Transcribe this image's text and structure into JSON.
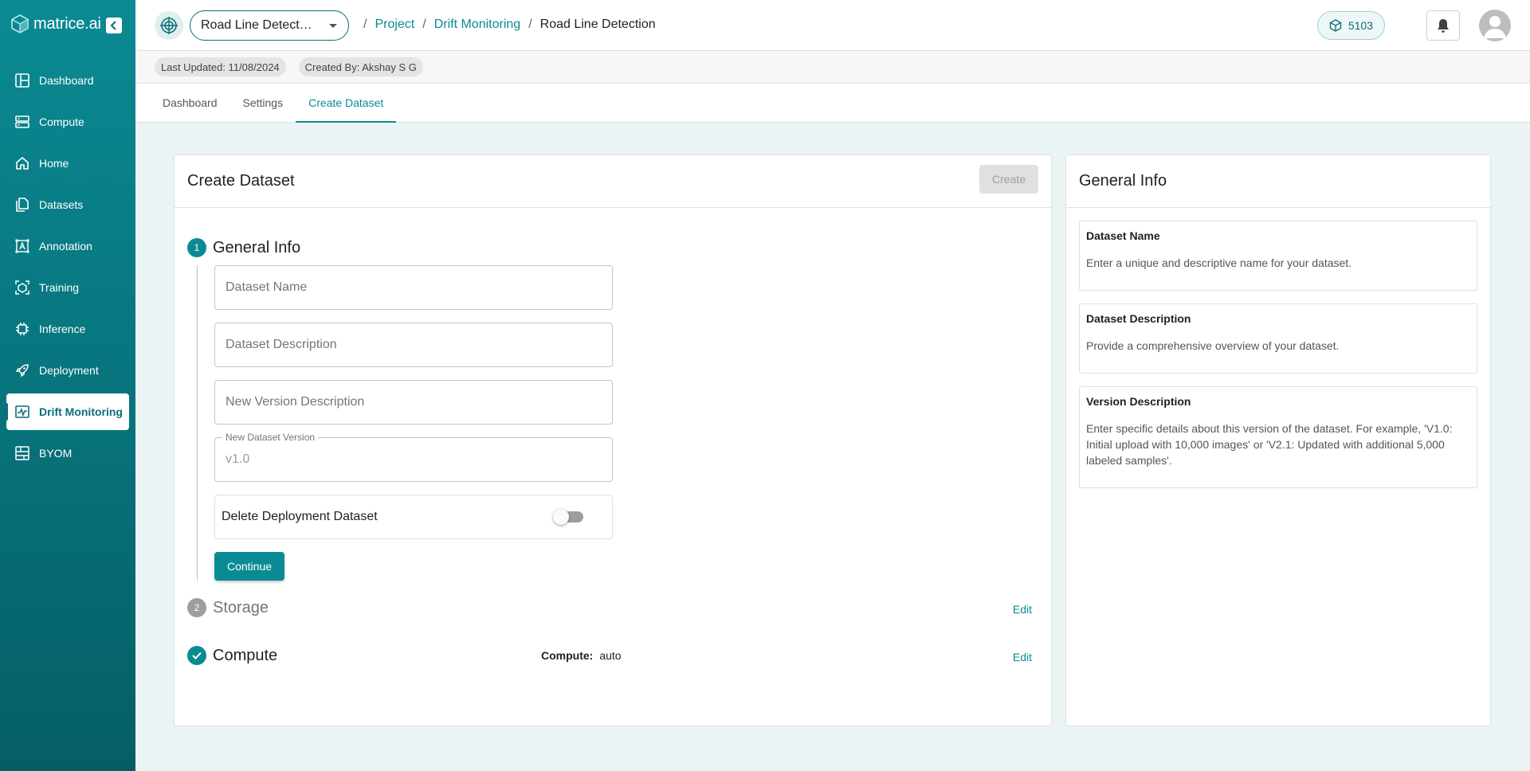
{
  "brand": {
    "name": "matrice.ai"
  },
  "sidebar": {
    "items": [
      {
        "label": "Dashboard",
        "icon": "dashboard-icon"
      },
      {
        "label": "Compute",
        "icon": "server-icon"
      },
      {
        "label": "Home",
        "icon": "home-icon"
      },
      {
        "label": "Datasets",
        "icon": "files-icon"
      },
      {
        "label": "Annotation",
        "icon": "annotation-icon"
      },
      {
        "label": "Training",
        "icon": "training-icon"
      },
      {
        "label": "Inference",
        "icon": "chip-icon"
      },
      {
        "label": "Deployment",
        "icon": "rocket-icon"
      },
      {
        "label": "Drift Monitoring",
        "icon": "monitor-icon",
        "active": true
      },
      {
        "label": "BYOM",
        "icon": "byom-icon"
      }
    ]
  },
  "header": {
    "project_select": "Road Line Detect…",
    "breadcrumb": [
      "Project",
      "Drift Monitoring",
      "Road Line Detection"
    ],
    "credits": "5103"
  },
  "meta": {
    "last_updated": "Last Updated: 11/08/2024",
    "created_by": "Created By: Akshay S G"
  },
  "tabs": [
    "Dashboard",
    "Settings",
    "Create Dataset"
  ],
  "main": {
    "title": "Create Dataset",
    "create_label": "Create",
    "steps": [
      {
        "number": "1",
        "title": "General Info"
      },
      {
        "number": "2",
        "title": "Storage",
        "edit": "Edit"
      },
      {
        "title": "Compute",
        "edit": "Edit",
        "compute_label": "Compute:",
        "compute_value": "auto"
      }
    ],
    "fields": {
      "dataset_name": "Dataset Name",
      "dataset_description": "Dataset Description",
      "new_version_description": "New Version Description",
      "new_dataset_version_label": "New Dataset Version",
      "new_dataset_version_value": "v1.0"
    },
    "toggle_label": "Delete Deployment Dataset",
    "toggle_on": false,
    "continue_label": "Continue"
  },
  "side": {
    "title": "General Info",
    "boxes": [
      {
        "title": "Dataset Name",
        "text": "Enter a unique and descriptive name for your dataset."
      },
      {
        "title": "Dataset Description",
        "text": "Provide a comprehensive overview of your dataset."
      },
      {
        "title": "Version Description",
        "text": "Enter specific details about this version of the dataset. For example, 'V1.0: Initial upload with 10,000 images' or 'V2.1: Updated with additional 5,000 labeled samples'."
      }
    ]
  },
  "colors": {
    "accent": "#0a8b94",
    "sidebar": "#07727b"
  }
}
